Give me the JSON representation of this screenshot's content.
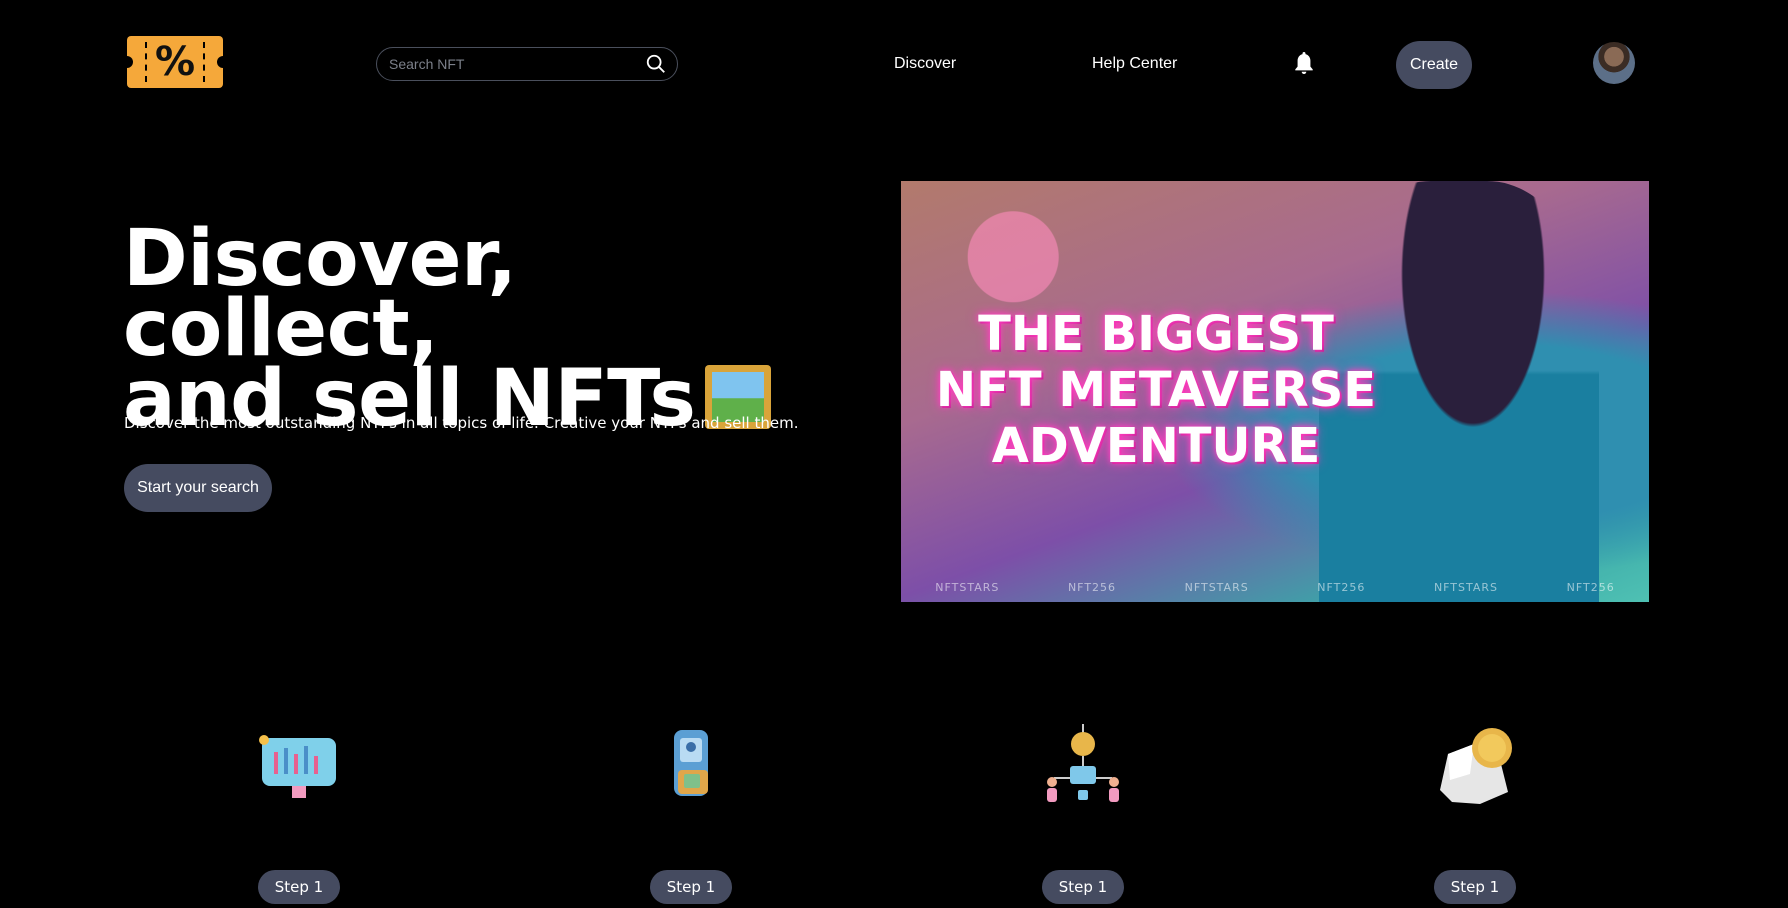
{
  "header": {
    "search": {
      "placeholder": "Search NFT",
      "value": ""
    },
    "nav": [
      {
        "label": "Discover"
      },
      {
        "label": "Help Center"
      }
    ],
    "create_label": "Create",
    "logo_symbol": "%"
  },
  "hero": {
    "title_line1": "Discover, collect,",
    "title_line2": "and sell NFTs",
    "subtitle": "Discover the most outstanding NTFs in all topics of life. Creative your NTFs and sell them.",
    "cta_label": "Start your search"
  },
  "banner": {
    "line1": "THE BIGGEST",
    "line2": "NFT METAVERSE",
    "line3": "ADVENTURE",
    "watermarks": [
      "NFTSTARS",
      "NFT256",
      "NFTSTARS",
      "NFT256",
      "NFTSTARS",
      "NFT256"
    ]
  },
  "steps": [
    {
      "label": "Step 1",
      "icon": "chart-monitor-icon"
    },
    {
      "label": "Step 1",
      "icon": "phone-wallet-icon"
    },
    {
      "label": "Step 1",
      "icon": "crypto-network-icon"
    },
    {
      "label": "Step 1",
      "icon": "coin-rock-icon"
    }
  ],
  "colors": {
    "background": "#000000",
    "button": "#454b60",
    "logo": "#F5A83A"
  }
}
